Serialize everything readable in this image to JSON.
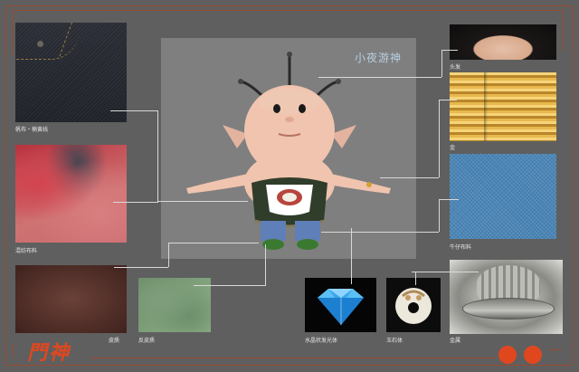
{
  "title": "小夜游神",
  "logo": "門神",
  "materials": [
    {
      "label": "帆布・楠黄线"
    },
    {
      "label": "混纺布料"
    },
    {
      "label": "皮质"
    },
    {
      "label": "反皮质"
    },
    {
      "label": "头发"
    },
    {
      "label": "金"
    },
    {
      "label": "牛仔布料"
    },
    {
      "label": "水晶状发光体"
    },
    {
      "label": "玉石体"
    },
    {
      "label": "金属"
    }
  ],
  "colors": {
    "accent": "#e0471f",
    "frame": "#9a4a30",
    "background": "#5f5f5f",
    "panel": "#7f7f7f"
  }
}
